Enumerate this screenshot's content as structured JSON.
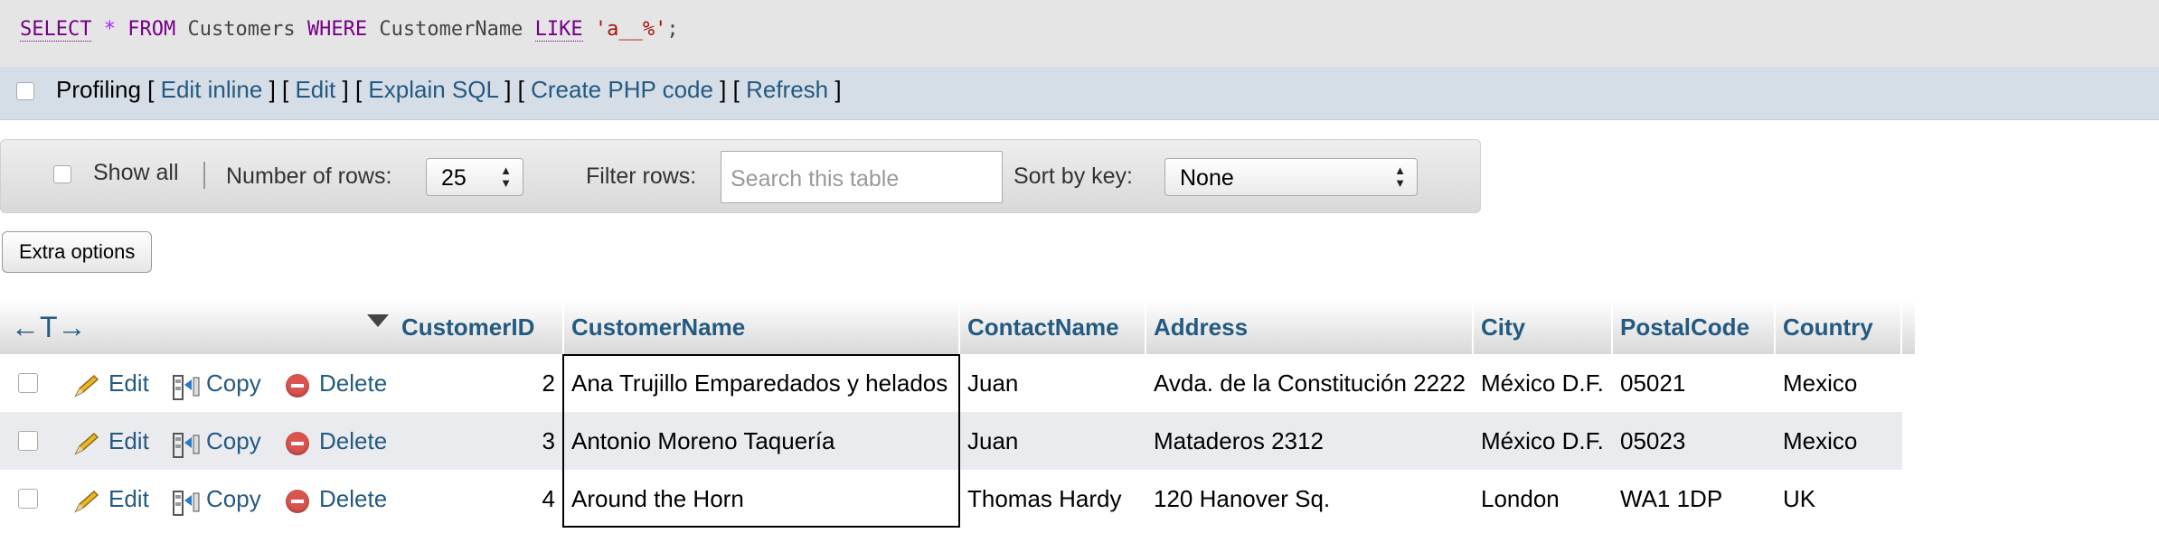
{
  "sql": {
    "select_kw": "SELECT",
    "star": "*",
    "from_kw": "FROM",
    "table": "Customers",
    "where_kw": "WHERE",
    "column": "CustomerName",
    "like_kw": "LIKE",
    "pattern": "'a__%'",
    "end": ";"
  },
  "tools": {
    "profiling": "Profiling",
    "edit_inline": "Edit inline",
    "edit": "Edit",
    "explain_sql": "Explain SQL",
    "create_php": "Create PHP code",
    "refresh": "Refresh"
  },
  "nav": {
    "show_all": "Show all",
    "rows_label": "Number of rows:",
    "rows_value": "25",
    "filter_label": "Filter rows:",
    "filter_placeholder": "Search this table",
    "sort_label": "Sort by key:",
    "sort_value": "None"
  },
  "extra_options": "Extra options",
  "table": {
    "arrows": "←T→",
    "columns": [
      "CustomerID",
      "CustomerName",
      "ContactName",
      "Address",
      "City",
      "PostalCode",
      "Country"
    ],
    "actions": {
      "edit": "Edit",
      "copy": "Copy",
      "delete": "Delete"
    },
    "rows": [
      {
        "id": "2",
        "name": "Ana Trujillo Emparedados y helados",
        "contact": "Juan",
        "address": "Avda. de la Constitución 2222",
        "city": "México D.F.",
        "postal": "05021",
        "country": "Mexico"
      },
      {
        "id": "3",
        "name": "Antonio Moreno Taquería",
        "contact": "Juan",
        "address": "Mataderos 2312",
        "city": "México D.F.",
        "postal": "05023",
        "country": "Mexico"
      },
      {
        "id": "4",
        "name": "Around the Horn",
        "contact": "Thomas Hardy",
        "address": "120 Hanover Sq.",
        "city": "London",
        "postal": "WA1 1DP",
        "country": "UK"
      }
    ]
  },
  "colors": {
    "link": "#235a81",
    "delete": "#d9534f",
    "keyword": "#770088",
    "string": "#aa1111"
  }
}
